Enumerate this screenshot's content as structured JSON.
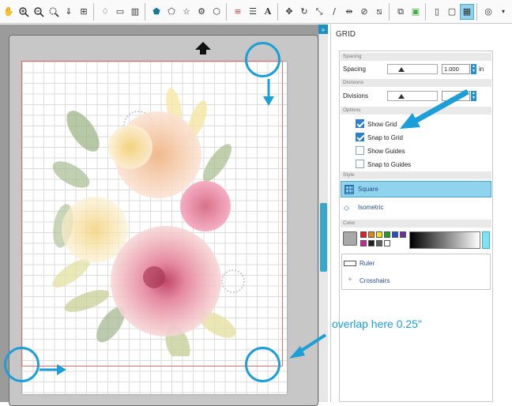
{
  "toolbar": {
    "icons": [
      "hand-icon",
      "zoom-in-icon",
      "zoom-out-icon",
      "zoom-box-icon",
      "zoom-fit-icon",
      "zoom-page-icon",
      "paint-bucket-icon",
      "panel-icon",
      "pentagon-icon",
      "polygon-icon",
      "star-icon",
      "gear-shape-icon",
      "shape-icon",
      "line-style-icon",
      "fill-pattern-icon",
      "text-icon",
      "move-icon",
      "rotate-icon",
      "scale-icon",
      "pen-icon",
      "mirror-icon",
      "eraser-icon",
      "knife-icon",
      "replicate-icon",
      "fill-icon",
      "page-icon",
      "canvas-icon",
      "grid-icon",
      "trace-icon",
      "more-icon"
    ],
    "text_tool_label": "A"
  },
  "panel": {
    "title": "GRID",
    "sections": {
      "spacing": "Spacing",
      "divisions": "Divisions",
      "options": "Options",
      "style": "Style",
      "color": "Color"
    },
    "spacing_label": "Spacing",
    "spacing_value": "1.000",
    "spacing_unit": "in",
    "divisions_label": "Divisions",
    "options": [
      {
        "label": "Show Grid",
        "checked": true
      },
      {
        "label": "Snap to Grid",
        "checked": true
      },
      {
        "label": "Show Guides",
        "checked": false
      },
      {
        "label": "Snap to Guides",
        "checked": false
      }
    ],
    "styles": [
      {
        "label": "Square",
        "selected": true
      },
      {
        "label": "Isometric",
        "selected": false
      }
    ],
    "palette": [
      "#a8a8a8",
      "#e02020",
      "#e88020",
      "#f2e020",
      "#20a020",
      "#2050d0",
      "#7030a0",
      "#d020a0",
      "#202020",
      "#606060",
      "#ffffff"
    ],
    "color_modes": [
      "Ruler",
      "Crosshairs"
    ]
  },
  "annotation": {
    "text": "overlap here 0.25\""
  }
}
